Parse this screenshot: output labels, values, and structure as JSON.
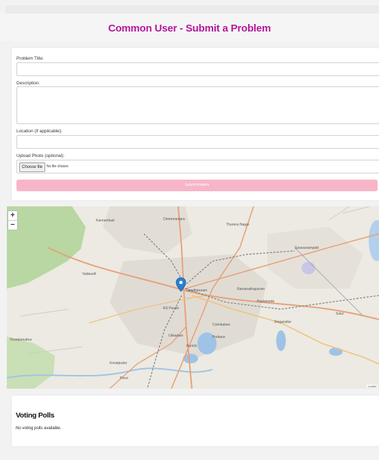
{
  "header": {
    "title": "Common User - Submit a Problem"
  },
  "form": {
    "problem_title_label": "Problem Title:",
    "problem_title_value": "",
    "description_label": "Description:",
    "description_value": "",
    "location_label": "Location (if applicable):",
    "location_value": "",
    "photo_label": "Upload Photo (optional):",
    "choose_file_label": "Choose file",
    "file_status": "No file chosen",
    "submit_label": "Submit Problem"
  },
  "map": {
    "zoom_in": "+",
    "zoom_out": "−",
    "attribution": "Leaflet",
    "marker_icon": "map-pin-icon",
    "places": [
      "Chemmumpra",
      "Thuranu Nagar",
      "Kannamkad",
      "Gandhipuram",
      "Coimbatore",
      "Peelamedu",
      "Singanallur",
      "Kurichi",
      "Vadavalli",
      "Thondamuthur",
      "Saravanampatti",
      "Podanur",
      "Ukkadam",
      "RS Puram",
      "Ramanathapuram",
      "Kovaipudur",
      "Perur",
      "Sulur"
    ],
    "colors": {
      "water": "#9ec3e6",
      "forest": "#b8d7a2",
      "urban": "#e0dcd4",
      "major_road": "#e8a07a",
      "rail": "#7d7d7d",
      "marker": "#2a7fd1"
    }
  },
  "polls": {
    "title": "Voting Polls",
    "empty_text": "No voting polls available."
  },
  "colors": {
    "accent": "#b5179e",
    "submit_bg": "#f7b6c8"
  }
}
